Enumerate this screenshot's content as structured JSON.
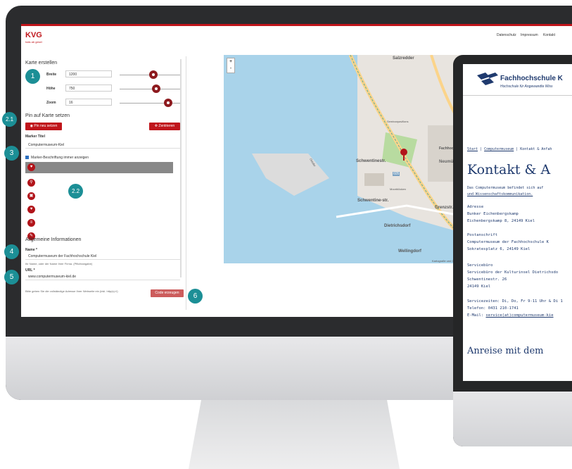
{
  "brand": {
    "logo": "KVG",
    "tagline": "hats ab gesel",
    "accent": "#c0151b"
  },
  "nav": {
    "items": [
      "Datenschutz",
      "Impressum",
      "Kontakt"
    ]
  },
  "form": {
    "section_title": "Karte erstellen",
    "fields": [
      {
        "label": "Breite",
        "value": "1200"
      },
      {
        "label": "Höhe",
        "value": "750"
      },
      {
        "label": "Zoom",
        "value": "16"
      }
    ],
    "pin_title": "Pin auf Karte setzen",
    "pin_button": "Pin neu setzen",
    "center_button": "Zentrieren",
    "marker_title_label": "Marker Titel",
    "marker_title_value": "Computermuseum-Kiel",
    "marker_checkbox_label": "Marker-Beschriftung immer anzeigen",
    "general_title": "Allgemeine Informationen",
    "name_label": "Name *",
    "name_value": "Computermuseum der Fachhochschule Kiel",
    "name_hint": "Ihr Name, oder der Name Ihrer Firma. (Pflichtangabe)",
    "url_label": "URL *",
    "url_value": "www.computermuseum-kiel.de",
    "url_hint": "Bitte geben Sie die vollständige Adresse Ihrer Webseite ein (inkl. http(s)://)",
    "generate_button": "Code erzeugen"
  },
  "callouts": [
    "1",
    "2.1",
    "2.2",
    "3",
    "4",
    "5",
    "6"
  ],
  "map": {
    "labels": [
      "Salzredder",
      "Fachhochschul",
      "Schwentinestr.",
      "Neumühlen-D",
      "Schwentine-str.",
      "Grenzstr.",
      "Dietrichsdorf",
      "Wellingdorf",
      "Ostufer",
      "Seminarpavillons",
      "605",
      "Moorblöcken",
      "Eikberg"
    ],
    "zoom_in": "+",
    "zoom_out": "-",
    "attribution": "Kartografie und Gestaltung: ©"
  },
  "site": {
    "title": "Fachhochschule K",
    "subtitle": "Hochschule für Angewandte Wiss",
    "breadcrumb": [
      "Start",
      "Computermuseum",
      "Kontakt & Anfah"
    ],
    "heading": "Kontakt & A",
    "intro": "Das Computermuseum befindet sich auf",
    "intro_link": "und Wissenschaftskommunikation.",
    "blocks": [
      {
        "title": "Adresse",
        "lines": [
          "Bunker Eichenbergskamp",
          "Eichenbergskamp 8, 24149 Kiel"
        ]
      },
      {
        "title": "Postanschrift",
        "lines": [
          "Computermuseum der Fachhochschule K",
          "Sokratesplatz 6, 24149 Kiel"
        ]
      },
      {
        "title": "Servicebüro",
        "lines": [
          "Servicebüro der Kulturinsel Dietrichsdo",
          "Schwentinestr. 26",
          "24149 Kiel"
        ]
      }
    ],
    "service_hours": "Servicezeiten: Di, Do, Fr 9-11 Uhr & Di 1",
    "phone": "Telefon: 0431 210-1741",
    "email_prefix": "E-Mail: ",
    "email": "service(at)computermuseum-kie",
    "section2": "Anreise mit dem"
  }
}
